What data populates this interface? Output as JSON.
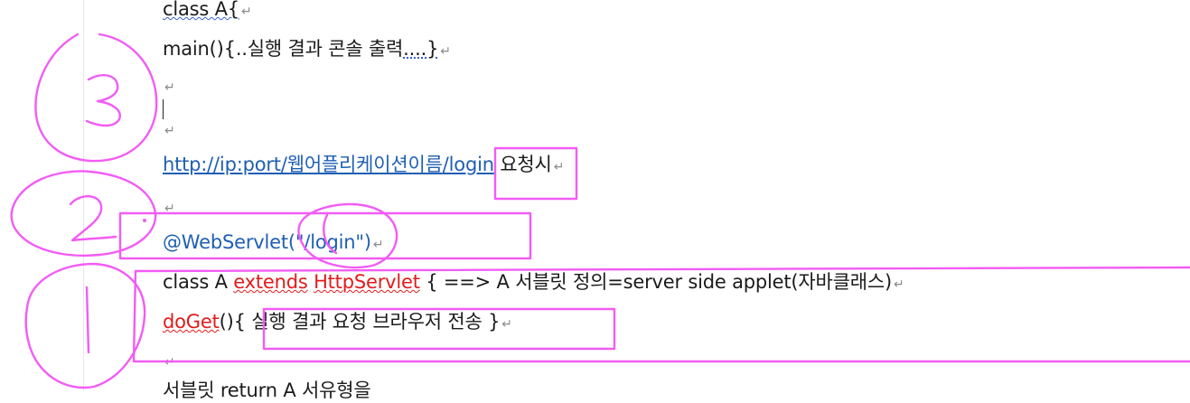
{
  "document": {
    "line1": {
      "pre": "class A{"
    },
    "line2": {
      "pre": "main(){..",
      "text": "실행 결과 콘솔 출력",
      "post": "....}"
    },
    "line5": {
      "url_prefix": "http://ip:port/웹어플리케이션이름",
      "url_tail": "/login",
      "suffix": "요청시"
    },
    "line7": {
      "annotation": "@WebServlet(",
      "string": "\"/login\"",
      "close": ")"
    },
    "line8": {
      "cls": "class A ",
      "extends": "extends",
      "parent": "HttpServlet",
      "rest": "{ ==> A 서블릿 정의=server side applet(자바클래스)"
    },
    "line9": {
      "method": "doGet",
      "open": "(){",
      "text": "실행 결과 요청 브라우저 전송",
      "close": "}"
    },
    "line11": {
      "text": "서블릿 return A 서유형을"
    }
  },
  "colors": {
    "link": "#1f5fb3",
    "keyword_red": "#e21b1b",
    "pen": "#f25cf5",
    "text": "#1b1b1b"
  },
  "handwriting": {
    "circled_numbers": [
      "3",
      "2",
      "1"
    ]
  }
}
